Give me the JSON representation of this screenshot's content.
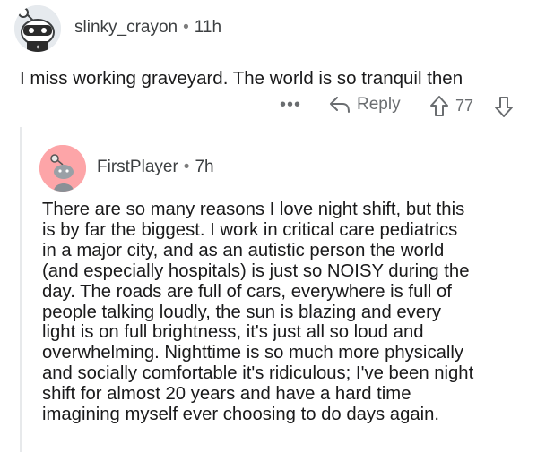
{
  "parent_comment": {
    "username": "slinky_crayon",
    "separator": "•",
    "age": "11h",
    "text": "I miss working graveyard. The world is so tranquil then",
    "actions": {
      "more_label": "•••",
      "reply_label": "Reply",
      "score": "77"
    }
  },
  "reply_comment": {
    "username": "FirstPlayer",
    "separator": "•",
    "age": "7h",
    "lines": [
      "There are so many reasons I love night shift, but this",
      "is by far the biggest. I work in critical care pediatrics",
      "in a major city, and as an autistic person the world",
      "(and especially hospitals) is just so NOISY during the",
      "day. The roads are full of cars, everywhere is full of",
      "people talking loudly, the sun is blazing and every",
      "light is on full brightness, it's just all so loud and",
      "overwhelming. Nighttime is so much more physically",
      "and socially comfortable it's ridiculous; I've been night",
      "shift for almost 20 years and have a hard time",
      "imagining myself ever choosing to do days again."
    ]
  },
  "colors": {
    "avatar1_bg": "#e6eaee",
    "avatar2_bg": "#fda5a8",
    "muted": "#6a6d70",
    "text": "#1a1a1b"
  }
}
